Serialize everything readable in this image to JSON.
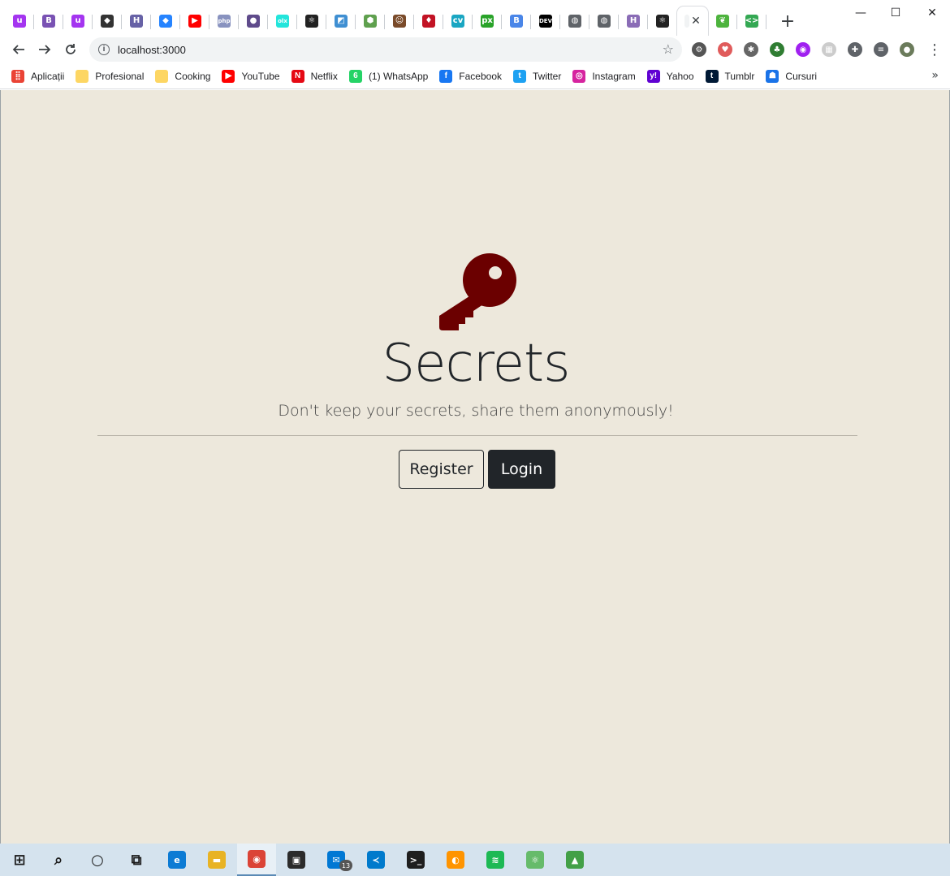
{
  "browser": {
    "tabs": [
      {
        "icon": "udemy-favicon",
        "glyph": "u",
        "color": "#a435f0"
      },
      {
        "icon": "bootstrap-favicon",
        "glyph": "B",
        "color": "#7952b3"
      },
      {
        "icon": "udemy-favicon",
        "glyph": "u",
        "color": "#a435f0"
      },
      {
        "icon": "codesandbox-favicon",
        "glyph": "◆",
        "color": "#333333"
      },
      {
        "icon": "heroku-favicon",
        "glyph": "H",
        "color": "#6762a6"
      },
      {
        "icon": "jira-favicon",
        "glyph": "◆",
        "color": "#2684ff"
      },
      {
        "icon": "youtube-favicon",
        "glyph": "▶",
        "color": "#ff0000"
      },
      {
        "icon": "php-favicon",
        "glyph": "php",
        "color": "#8892bf"
      },
      {
        "icon": "circle-favicon",
        "glyph": "●",
        "color": "#5f4b8b"
      },
      {
        "icon": "olx-favicon",
        "glyph": "olx",
        "color": "#23e5db"
      },
      {
        "icon": "react-favicon",
        "glyph": "⚛",
        "color": "#222222"
      },
      {
        "icon": "square-favicon",
        "glyph": "◩",
        "color": "#3f8fd2"
      },
      {
        "icon": "nodejs-favicon",
        "glyph": "⬢",
        "color": "#5fa04e"
      },
      {
        "icon": "avatar-favicon",
        "glyph": "☺",
        "color": "#7a4b2a"
      },
      {
        "icon": "jest-favicon",
        "glyph": "♦",
        "color": "#c21325"
      },
      {
        "icon": "cv-favicon",
        "glyph": "cv",
        "color": "#1aa6c2"
      },
      {
        "icon": "px-favicon",
        "glyph": "px",
        "color": "#29a329"
      },
      {
        "icon": "blogger-favicon",
        "glyph": "B",
        "color": "#4a86e8"
      },
      {
        "icon": "dev-favicon",
        "glyph": "DEV",
        "color": "#000000"
      },
      {
        "icon": "globe-favicon",
        "glyph": "◍",
        "color": "#5f6368"
      },
      {
        "icon": "globe-favicon",
        "glyph": "◍",
        "color": "#5f6368"
      },
      {
        "icon": "hackerrank-favicon",
        "glyph": "H",
        "color": "#8a6cb6"
      },
      {
        "icon": "react-favicon",
        "glyph": "⚛",
        "color": "#222222"
      }
    ],
    "active_tab": {
      "icon": "blank-favicon",
      "close": "✕"
    },
    "trailing_tabs": [
      {
        "icon": "mongodb-favicon",
        "glyph": "❦",
        "color": "#4db33d"
      },
      {
        "icon": "code-favicon",
        "glyph": "<>",
        "color": "#34a853"
      }
    ],
    "new_tab": "+",
    "window_controls": {
      "minimize": "—",
      "maximize": "☐",
      "close": "✕"
    },
    "url": "localhost:3000",
    "extensions": [
      {
        "icon": "gear-extension-icon",
        "glyph": "⚙",
        "color": "#555555"
      },
      {
        "icon": "shield-extension-icon",
        "glyph": "♥",
        "color": "#e05b5b"
      },
      {
        "icon": "bug-extension-icon",
        "glyph": "✱",
        "color": "#666666"
      },
      {
        "icon": "tree-extension-icon",
        "glyph": "♣",
        "color": "#2f7d32"
      },
      {
        "icon": "colorzilla-extension-icon",
        "glyph": "◉",
        "color": "#a020f0"
      },
      {
        "icon": "grid-extension-icon",
        "glyph": "▦",
        "color": "#cccccc"
      },
      {
        "icon": "puzzle-extension-icon",
        "glyph": "✚",
        "color": "#5f6368"
      },
      {
        "icon": "media-queue-icon",
        "glyph": "≡",
        "color": "#5f6368"
      },
      {
        "icon": "profile-avatar-icon",
        "glyph": "●",
        "color": "#6b7b5b"
      }
    ],
    "menu": "⋮",
    "bookmarks": [
      {
        "label": "Aplicații",
        "icon": "apps-grid-icon",
        "glyph": "⣿",
        "color": "#ea4335"
      },
      {
        "label": "Profesional",
        "icon": "folder-icon",
        "glyph": "",
        "color": "#fdd663"
      },
      {
        "label": "Cooking",
        "icon": "folder-icon",
        "glyph": "",
        "color": "#fdd663"
      },
      {
        "label": "YouTube",
        "icon": "youtube-icon",
        "glyph": "▶",
        "color": "#ff0000"
      },
      {
        "label": "Netflix",
        "icon": "netflix-icon",
        "glyph": "N",
        "color": "#e50914"
      },
      {
        "label": "(1) WhatsApp",
        "icon": "whatsapp-icon",
        "glyph": "6",
        "color": "#25d366"
      },
      {
        "label": "Facebook",
        "icon": "facebook-icon",
        "glyph": "f",
        "color": "#1877f2"
      },
      {
        "label": "Twitter",
        "icon": "twitter-icon",
        "glyph": "t",
        "color": "#1da1f2"
      },
      {
        "label": "Instagram",
        "icon": "instagram-icon",
        "glyph": "◎",
        "color": "#d6249f"
      },
      {
        "label": "Yahoo",
        "icon": "yahoo-icon",
        "glyph": "y!",
        "color": "#6001d2"
      },
      {
        "label": "Tumblr",
        "icon": "tumblr-icon",
        "glyph": "t",
        "color": "#001935"
      },
      {
        "label": "Cursuri",
        "icon": "classroom-icon",
        "glyph": "☗",
        "color": "#1a73e8"
      }
    ],
    "bookmarks_more": "»"
  },
  "page": {
    "title": "Secrets",
    "lead": "Don't keep your secrets, share them anonymously!",
    "register_label": "Register",
    "login_label": "Login",
    "background": "#ede8dc",
    "key_color": "#6b0000"
  },
  "taskbar": {
    "items": [
      {
        "name": "start-button",
        "icon": "windows-icon",
        "glyph": "⊞",
        "color": "#1a1a1a"
      },
      {
        "name": "search-button",
        "icon": "search-icon",
        "glyph": "⌕",
        "color": "#1a1a1a"
      },
      {
        "name": "cortana-button",
        "icon": "cortana-circle-icon",
        "glyph": "○",
        "color": "#1a1a1a"
      },
      {
        "name": "task-view-button",
        "icon": "task-view-icon",
        "glyph": "⧉",
        "color": "#1a1a1a"
      },
      {
        "name": "edge-app",
        "icon": "edge-icon",
        "glyph": "e",
        "color": "#0c7bd4"
      },
      {
        "name": "file-explorer-app",
        "icon": "folder-icon",
        "glyph": "▬",
        "color": "#e8b324"
      },
      {
        "name": "chrome-app",
        "icon": "chrome-icon",
        "glyph": "◉",
        "color": "#db4437"
      },
      {
        "name": "store-app",
        "icon": "store-bag-icon",
        "glyph": "▣",
        "color": "#2b2b2b"
      },
      {
        "name": "mail-app",
        "icon": "mail-icon",
        "glyph": "✉",
        "color": "#0078d4"
      },
      {
        "name": "vscode-app",
        "icon": "vscode-icon",
        "glyph": "≺",
        "color": "#007acc"
      },
      {
        "name": "hyper-terminal-app",
        "icon": "terminal-icon",
        "glyph": ">_",
        "color": "#1e1e1e"
      },
      {
        "name": "firefox-app",
        "icon": "browser-flame-icon",
        "glyph": "◐",
        "color": "#ff9400"
      },
      {
        "name": "spotify-app",
        "icon": "spotify-icon",
        "glyph": "≋",
        "color": "#1db954"
      },
      {
        "name": "atom-app",
        "icon": "atom-icon",
        "glyph": "⚛",
        "color": "#66bb6a"
      },
      {
        "name": "rocket-app",
        "icon": "rocket-icon",
        "glyph": "▲",
        "color": "#43a047"
      }
    ],
    "mail_badge": "13"
  }
}
